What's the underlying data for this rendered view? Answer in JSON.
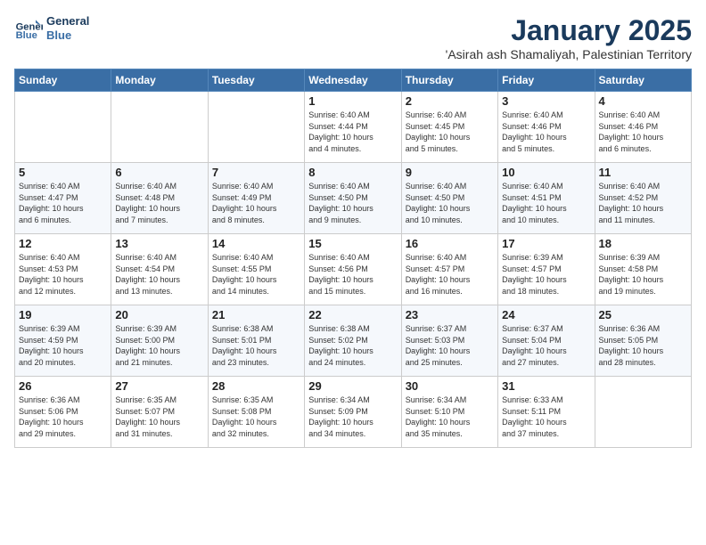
{
  "header": {
    "logo_line1": "General",
    "logo_line2": "Blue",
    "month": "January 2025",
    "location": "'Asirah ash Shamaliyah, Palestinian Territory"
  },
  "weekdays": [
    "Sunday",
    "Monday",
    "Tuesday",
    "Wednesday",
    "Thursday",
    "Friday",
    "Saturday"
  ],
  "weeks": [
    [
      {
        "day": "",
        "info": ""
      },
      {
        "day": "",
        "info": ""
      },
      {
        "day": "",
        "info": ""
      },
      {
        "day": "1",
        "info": "Sunrise: 6:40 AM\nSunset: 4:44 PM\nDaylight: 10 hours\nand 4 minutes."
      },
      {
        "day": "2",
        "info": "Sunrise: 6:40 AM\nSunset: 4:45 PM\nDaylight: 10 hours\nand 5 minutes."
      },
      {
        "day": "3",
        "info": "Sunrise: 6:40 AM\nSunset: 4:46 PM\nDaylight: 10 hours\nand 5 minutes."
      },
      {
        "day": "4",
        "info": "Sunrise: 6:40 AM\nSunset: 4:46 PM\nDaylight: 10 hours\nand 6 minutes."
      }
    ],
    [
      {
        "day": "5",
        "info": "Sunrise: 6:40 AM\nSunset: 4:47 PM\nDaylight: 10 hours\nand 6 minutes."
      },
      {
        "day": "6",
        "info": "Sunrise: 6:40 AM\nSunset: 4:48 PM\nDaylight: 10 hours\nand 7 minutes."
      },
      {
        "day": "7",
        "info": "Sunrise: 6:40 AM\nSunset: 4:49 PM\nDaylight: 10 hours\nand 8 minutes."
      },
      {
        "day": "8",
        "info": "Sunrise: 6:40 AM\nSunset: 4:50 PM\nDaylight: 10 hours\nand 9 minutes."
      },
      {
        "day": "9",
        "info": "Sunrise: 6:40 AM\nSunset: 4:50 PM\nDaylight: 10 hours\nand 10 minutes."
      },
      {
        "day": "10",
        "info": "Sunrise: 6:40 AM\nSunset: 4:51 PM\nDaylight: 10 hours\nand 10 minutes."
      },
      {
        "day": "11",
        "info": "Sunrise: 6:40 AM\nSunset: 4:52 PM\nDaylight: 10 hours\nand 11 minutes."
      }
    ],
    [
      {
        "day": "12",
        "info": "Sunrise: 6:40 AM\nSunset: 4:53 PM\nDaylight: 10 hours\nand 12 minutes."
      },
      {
        "day": "13",
        "info": "Sunrise: 6:40 AM\nSunset: 4:54 PM\nDaylight: 10 hours\nand 13 minutes."
      },
      {
        "day": "14",
        "info": "Sunrise: 6:40 AM\nSunset: 4:55 PM\nDaylight: 10 hours\nand 14 minutes."
      },
      {
        "day": "15",
        "info": "Sunrise: 6:40 AM\nSunset: 4:56 PM\nDaylight: 10 hours\nand 15 minutes."
      },
      {
        "day": "16",
        "info": "Sunrise: 6:40 AM\nSunset: 4:57 PM\nDaylight: 10 hours\nand 16 minutes."
      },
      {
        "day": "17",
        "info": "Sunrise: 6:39 AM\nSunset: 4:57 PM\nDaylight: 10 hours\nand 18 minutes."
      },
      {
        "day": "18",
        "info": "Sunrise: 6:39 AM\nSunset: 4:58 PM\nDaylight: 10 hours\nand 19 minutes."
      }
    ],
    [
      {
        "day": "19",
        "info": "Sunrise: 6:39 AM\nSunset: 4:59 PM\nDaylight: 10 hours\nand 20 minutes."
      },
      {
        "day": "20",
        "info": "Sunrise: 6:39 AM\nSunset: 5:00 PM\nDaylight: 10 hours\nand 21 minutes."
      },
      {
        "day": "21",
        "info": "Sunrise: 6:38 AM\nSunset: 5:01 PM\nDaylight: 10 hours\nand 23 minutes."
      },
      {
        "day": "22",
        "info": "Sunrise: 6:38 AM\nSunset: 5:02 PM\nDaylight: 10 hours\nand 24 minutes."
      },
      {
        "day": "23",
        "info": "Sunrise: 6:37 AM\nSunset: 5:03 PM\nDaylight: 10 hours\nand 25 minutes."
      },
      {
        "day": "24",
        "info": "Sunrise: 6:37 AM\nSunset: 5:04 PM\nDaylight: 10 hours\nand 27 minutes."
      },
      {
        "day": "25",
        "info": "Sunrise: 6:36 AM\nSunset: 5:05 PM\nDaylight: 10 hours\nand 28 minutes."
      }
    ],
    [
      {
        "day": "26",
        "info": "Sunrise: 6:36 AM\nSunset: 5:06 PM\nDaylight: 10 hours\nand 29 minutes."
      },
      {
        "day": "27",
        "info": "Sunrise: 6:35 AM\nSunset: 5:07 PM\nDaylight: 10 hours\nand 31 minutes."
      },
      {
        "day": "28",
        "info": "Sunrise: 6:35 AM\nSunset: 5:08 PM\nDaylight: 10 hours\nand 32 minutes."
      },
      {
        "day": "29",
        "info": "Sunrise: 6:34 AM\nSunset: 5:09 PM\nDaylight: 10 hours\nand 34 minutes."
      },
      {
        "day": "30",
        "info": "Sunrise: 6:34 AM\nSunset: 5:10 PM\nDaylight: 10 hours\nand 35 minutes."
      },
      {
        "day": "31",
        "info": "Sunrise: 6:33 AM\nSunset: 5:11 PM\nDaylight: 10 hours\nand 37 minutes."
      },
      {
        "day": "",
        "info": ""
      }
    ]
  ]
}
